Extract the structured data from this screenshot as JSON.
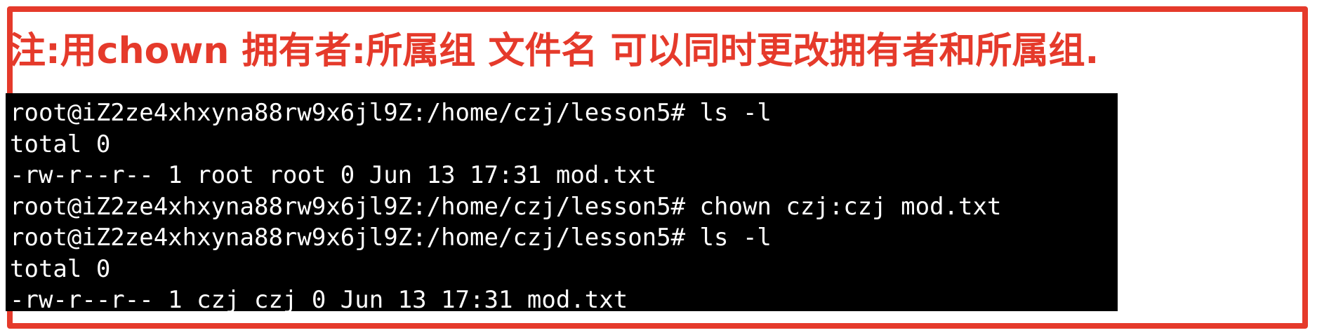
{
  "annotation": {
    "note": "注:用chown 拥有者:所属组 文件名 可以同时更改拥有者和所属组."
  },
  "terminal": {
    "lines": [
      "root@iZ2ze4xhxyna88rw9x6jl9Z:/home/czj/lesson5# ls -l",
      "total 0",
      "-rw-r--r-- 1 root root 0 Jun 13 17:31 mod.txt",
      "root@iZ2ze4xhxyna88rw9x6jl9Z:/home/czj/lesson5# chown czj:czj mod.txt",
      "root@iZ2ze4xhxyna88rw9x6jl9Z:/home/czj/lesson5# ls -l",
      "total 0",
      "-rw-r--r-- 1 czj czj 0 Jun 13 17:31 mod.txt"
    ]
  },
  "colors": {
    "accent_red": "#e53a2b",
    "terminal_bg": "#000000",
    "terminal_fg": "#ffffff"
  }
}
